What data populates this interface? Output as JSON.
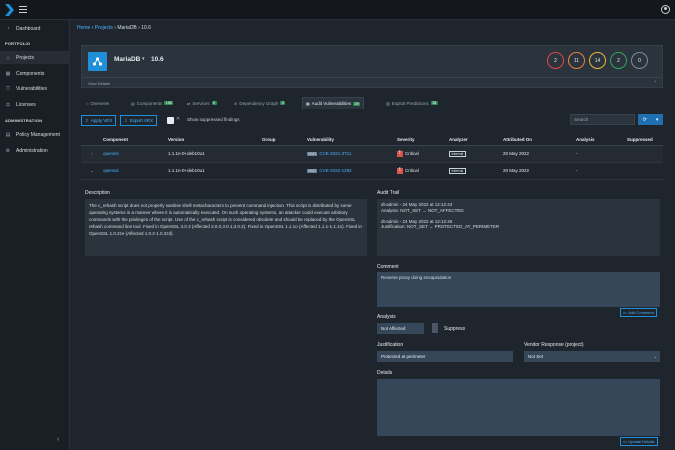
{
  "sidebar": {
    "dashboard": "Dashboard",
    "section_portfolio": "PORTFOLIO",
    "projects": "Projects",
    "components": "Components",
    "vulnerabilities": "Vulnerabilities",
    "licenses": "Licenses",
    "section_administration": "ADMINISTRATION",
    "policy_management": "Policy Management",
    "administration": "Administration",
    "collapse": "‹"
  },
  "breadcrumb": {
    "home": "Home",
    "sep": "›",
    "projects": "Projects",
    "current": "MariaDB › 10.6"
  },
  "project": {
    "name": "MariaDB",
    "caret": "▾",
    "version": "10.6",
    "view_details": "View Details",
    "view_caret": "›",
    "badges": [
      {
        "value": "2",
        "color": "#e0474c"
      },
      {
        "value": "11",
        "color": "#e8833a"
      },
      {
        "value": "14",
        "color": "#e8b83a"
      },
      {
        "value": "2",
        "color": "#2ea85a"
      },
      {
        "value": "0",
        "color": "#7f8c99"
      }
    ]
  },
  "tabs": [
    {
      "label": "Overview",
      "icon": "⌂",
      "count": ""
    },
    {
      "label": "Components",
      "icon": "▤",
      "count": "156"
    },
    {
      "label": "Services",
      "icon": "⇄",
      "count": "0"
    },
    {
      "label": "Dependency Graph",
      "icon": "⋔",
      "count": "0"
    },
    {
      "label": "Audit Vulnerabilities",
      "icon": "▦",
      "count": "29"
    },
    {
      "label": "Exploit Predictions",
      "icon": "▥",
      "count": "28"
    }
  ],
  "toolbar": {
    "apply_vex": "Apply VEX",
    "export_vex": "Export VEX",
    "show_suppressed": "Show suppressed findings",
    "search_placeholder": "Search",
    "refresh": "⟳",
    "dropdown": "▾"
  },
  "table": {
    "headers": [
      "Component",
      "Version",
      "Group",
      "Vulnerability",
      "Severity",
      "Analyzer",
      "Attributed On",
      "Analysis",
      "Suppressed"
    ],
    "rows": [
      {
        "expand": "›",
        "component": "openssl",
        "version": "1.1.1n-0+deb10u1",
        "group": "",
        "source": "NVD",
        "vulnerability": "CVE-2021-3711",
        "severity": "Critical",
        "analyzer": "Internal",
        "attributed_on": "20 May 2022",
        "analysis": "-",
        "suppressed": ""
      },
      {
        "expand": "⌄",
        "component": "openssl",
        "version": "1.1.1n-0+deb10u1",
        "group": "",
        "source": "NVD",
        "vulnerability": "CVE-2022-1292",
        "severity": "Critical",
        "analyzer": "Internal",
        "attributed_on": "20 May 2022",
        "analysis": "-",
        "suppressed": ""
      }
    ]
  },
  "detail": {
    "description_label": "Description",
    "description": "The c_rehash script does not properly sanitise shell metacharacters to prevent command injection. This script is distributed by some operating systems in a manner where it is automatically executed. On such operating systems, an attacker could execute arbitrary commands with the privileges of the script. Use of the c_rehash script is considered obsolete and should be replaced by the OpenSSL rehash command line tool. Fixed in OpenSSL 3.0.3 (Affected 3.0.0,3.0.1,3.0.2). Fixed in OpenSSL 1.1.1o (Affected 1.1.1-1.1.1n). Fixed in OpenSSL 1.0.2ze (Affected 1.0.2-1.0.2zd).",
    "audit_label": "Audit Trail",
    "audit_lines": [
      "dt-admin - 24 May 2022 at 12:12:43",
      "Analysis: NOT_SET → NOT_AFFECTED",
      "",
      "dt-admin - 24 May 2022 at 12:12:46",
      "Justification: NOT_SET → PROTECTED_AT_PERIMETER"
    ],
    "comment_label": "Comment",
    "comment_value": "Reverse proxy doing encapsulation",
    "add_comment": "Add Comment",
    "analysis_label": "Analysis",
    "analysis_value": "Not Affected",
    "suppress_label": "Suppress",
    "justification_label": "Justification",
    "justification_value": "Protected at perimeter",
    "vendor_label": "Vendor Response (project)",
    "vendor_value": "Not Set",
    "details_label": "Details",
    "update_details": "Update Details"
  }
}
